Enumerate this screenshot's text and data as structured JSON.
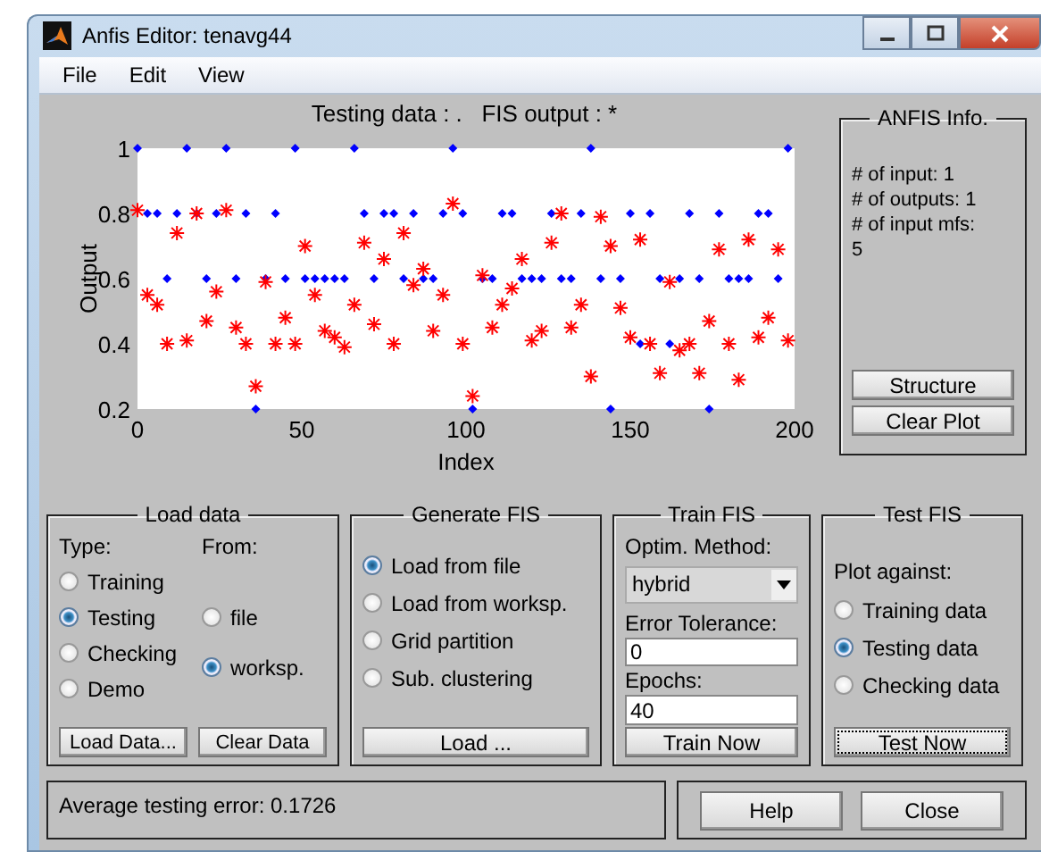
{
  "window": {
    "title": "Anfis Editor: tenavg44"
  },
  "menu": [
    "File",
    "Edit",
    "View"
  ],
  "chart": {
    "chart_data": {
      "type": "scatter",
      "title": "Testing data : .   FIS output : *",
      "xlabel": "Index",
      "ylabel": "Output",
      "xlim": [
        0,
        200
      ],
      "ylim": [
        0.2,
        1
      ],
      "xticks": [
        0,
        50,
        100,
        150,
        200
      ],
      "yticks": [
        0.2,
        0.4,
        0.6,
        0.8,
        1
      ],
      "x": [
        0,
        3,
        6,
        9,
        12,
        15,
        18,
        21,
        24,
        27,
        30,
        33,
        36,
        39,
        42,
        45,
        48,
        51,
        54,
        57,
        60,
        63,
        66,
        69,
        72,
        75,
        78,
        81,
        84,
        87,
        90,
        93,
        96,
        99,
        102,
        105,
        108,
        111,
        114,
        117,
        120,
        123,
        126,
        129,
        132,
        135,
        138,
        141,
        144,
        147,
        150,
        153,
        156,
        159,
        162,
        165,
        168,
        171,
        174,
        177,
        180,
        183,
        186,
        189,
        192,
        195,
        198
      ],
      "series": [
        {
          "color": "#0000ff",
          "values": [
            1,
            0.8,
            0.8,
            0.6,
            0.8,
            1,
            0.8,
            0.6,
            0.8,
            1,
            0.6,
            0.8,
            0.2,
            0.6,
            0.8,
            0.6,
            1,
            0.6,
            0.6,
            0.6,
            0.6,
            0.6,
            1,
            0.8,
            0.6,
            0.8,
            0.8,
            0.6,
            0.8,
            0.6,
            0.6,
            0.8,
            1,
            0.8,
            0.2,
            0.6,
            0.6,
            0.8,
            0.8,
            0.6,
            0.6,
            0.6,
            0.8,
            0.6,
            0.6,
            0.8,
            1,
            0.6,
            0.2,
            0.6,
            0.8,
            0.4,
            0.8,
            0.6,
            0.4,
            0.6,
            0.8,
            0.6,
            0.2,
            0.8,
            0.6,
            0.6,
            0.6,
            0.8,
            0.8,
            0.6,
            1
          ]
        },
        {
          "color": "#ff0000",
          "values": [
            0.81,
            0.55,
            0.52,
            0.4,
            0.74,
            0.41,
            0.8,
            0.47,
            0.56,
            0.81,
            0.45,
            0.4,
            0.27,
            0.59,
            0.4,
            0.48,
            0.4,
            0.7,
            0.55,
            0.44,
            0.42,
            0.39,
            0.52,
            0.71,
            0.46,
            0.66,
            0.4,
            0.74,
            0.58,
            0.63,
            0.44,
            0.55,
            0.83,
            0.4,
            0.24,
            0.61,
            0.45,
            0.52,
            0.57,
            0.66,
            0.41,
            0.44,
            0.71,
            0.8,
            0.45,
            0.52,
            0.3,
            0.79,
            0.7,
            0.51,
            0.42,
            0.72,
            0.4,
            0.31,
            0.59,
            0.38,
            0.4,
            0.31,
            0.47,
            0.69,
            0.4,
            0.29,
            0.72,
            0.42,
            0.48,
            0.69,
            0.41
          ]
        }
      ]
    }
  },
  "anfis_info": {
    "title": "ANFIS Info.",
    "lines": [
      "# of input: 1",
      "# of outputs: 1",
      "# of input mfs:",
      "5"
    ],
    "buttons": [
      "Structure",
      "Clear Plot"
    ]
  },
  "load_data": {
    "title": "Load data",
    "type_label": "Type:",
    "from_label": "From:",
    "types": [
      {
        "label": "Training",
        "selected": false
      },
      {
        "label": "Testing",
        "selected": true
      },
      {
        "label": "Checking",
        "selected": false
      },
      {
        "label": "Demo",
        "selected": false
      }
    ],
    "sources": [
      {
        "label": "file",
        "selected": false
      },
      {
        "label": "worksp.",
        "selected": true
      }
    ],
    "buttons": [
      "Load Data...",
      "Clear Data"
    ]
  },
  "generate_fis": {
    "title": "Generate FIS",
    "options": [
      {
        "label": "Load from file",
        "selected": true
      },
      {
        "label": "Load from worksp.",
        "selected": false
      },
      {
        "label": "Grid partition",
        "selected": false
      },
      {
        "label": "Sub. clustering",
        "selected": false
      }
    ],
    "button": "Load ..."
  },
  "train_fis": {
    "title": "Train FIS",
    "method_label": "Optim. Method:",
    "method": "hybrid",
    "tolerance_label": "Error Tolerance:",
    "tolerance": "0",
    "epochs_label": "Epochs:",
    "epochs": "40",
    "button": "Train Now"
  },
  "test_fis": {
    "title": "Test FIS",
    "plot_label": "Plot against:",
    "options": [
      {
        "label": "Training data",
        "selected": false
      },
      {
        "label": "Testing data",
        "selected": true
      },
      {
        "label": "Checking data",
        "selected": false
      }
    ],
    "button": {
      "label": "Test Now",
      "focused": true
    }
  },
  "status": "Average testing error: 0.1726",
  "footer_buttons": [
    "Help",
    "Close"
  ]
}
